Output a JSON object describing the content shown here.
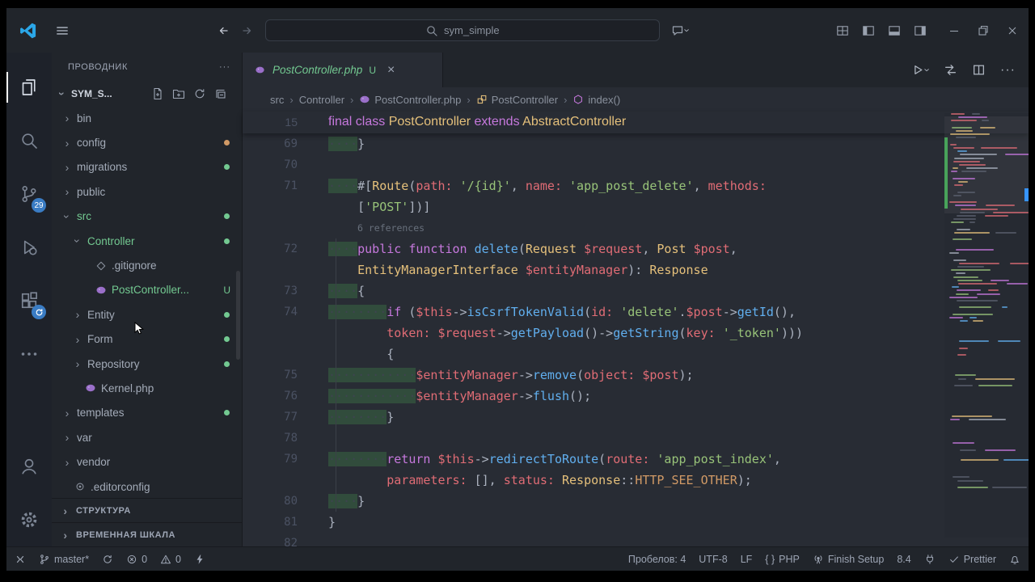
{
  "colors": {
    "kw": "#c678dd",
    "type": "#e5c07b",
    "fn": "#61afef",
    "var": "#e06c75",
    "str": "#98c379",
    "const": "#d19a66",
    "fg": "#abb2bf",
    "untracked": "#73c991",
    "badge": "#3a7cc4",
    "accent": "#3794ff",
    "editor_bg": "#282c34",
    "panel_bg": "#21252b"
  },
  "titlebar": {
    "search": "sym_simple"
  },
  "activity": {
    "items": [
      "explorer",
      "search",
      "source-control",
      "run-debug",
      "extensions",
      "more"
    ],
    "bottom": [
      "account",
      "settings"
    ],
    "scm_badge": "29"
  },
  "sidebar": {
    "title": "ПРОВОДНИК",
    "workspace": "SYM_S...",
    "tree": [
      {
        "label": "bin",
        "type": "folder",
        "level": 0
      },
      {
        "label": "config",
        "type": "folder",
        "level": 0,
        "dot": "#d19a66"
      },
      {
        "label": "migrations",
        "type": "folder",
        "level": 0,
        "dot": "#73c991"
      },
      {
        "label": "public",
        "type": "folder",
        "level": 0
      },
      {
        "label": "src",
        "type": "folder",
        "level": 0,
        "expanded": true,
        "color": "#73c991",
        "dot": "#73c991"
      },
      {
        "label": "Controller",
        "type": "folder",
        "level": 1,
        "expanded": true,
        "color": "#73c991",
        "dot": "#73c991"
      },
      {
        "label": ".gitignore",
        "type": "file",
        "icon": "gitfile",
        "level": 2
      },
      {
        "label": "PostController...",
        "type": "file",
        "icon": "php",
        "level": 2,
        "color": "#73c991",
        "badge": "U"
      },
      {
        "label": "Entity",
        "type": "folder",
        "level": 1,
        "dot": "#73c991"
      },
      {
        "label": "Form",
        "type": "folder",
        "level": 1,
        "dot": "#73c991"
      },
      {
        "label": "Repository",
        "type": "folder",
        "level": 1,
        "dot": "#73c991"
      },
      {
        "label": "Kernel.php",
        "type": "file",
        "icon": "php",
        "level": 1
      },
      {
        "label": "templates",
        "type": "folder",
        "level": 0,
        "dot": "#73c991"
      },
      {
        "label": "var",
        "type": "folder",
        "level": 0
      },
      {
        "label": "vendor",
        "type": "folder",
        "level": 0
      },
      {
        "label": ".editorconfig",
        "type": "file",
        "icon": "conffile",
        "level": 0
      }
    ],
    "sections": [
      {
        "label": "СТРУКТУРА"
      },
      {
        "label": "ВРЕМЕННАЯ ШКАЛА"
      }
    ]
  },
  "tab": {
    "title": "PostController.php",
    "git_badge": "U"
  },
  "breadcrumbs": [
    {
      "label": "src"
    },
    {
      "label": "Controller"
    },
    {
      "label": "PostController.php",
      "icon": "php"
    },
    {
      "label": "PostController",
      "icon": "classsym"
    },
    {
      "label": "index()",
      "icon": "methodsym"
    }
  ],
  "editor": {
    "sticky": {
      "n": "15",
      "ind": 0,
      "tk": [
        [
          "final class ",
          "k"
        ],
        [
          "PostController",
          "t"
        ],
        [
          " ",
          "p"
        ],
        [
          "extends",
          "k"
        ],
        [
          " ",
          "p"
        ],
        [
          "AbstractController",
          "t"
        ]
      ]
    },
    "lines": [
      {
        "n": "69",
        "ind": 4,
        "g": true,
        "tk": [
          [
            "}",
            "p"
          ]
        ]
      },
      {
        "n": "70",
        "ind": 0,
        "tk": []
      },
      {
        "n": "71",
        "ind": 4,
        "g": true,
        "tk": [
          [
            "#[",
            "p"
          ],
          [
            "Route",
            "t"
          ],
          [
            "(",
            "p"
          ],
          [
            "path:",
            "v"
          ],
          [
            " ",
            "p"
          ],
          [
            "'/{id}'",
            "s"
          ],
          [
            ", ",
            "p"
          ],
          [
            "name:",
            "v"
          ],
          [
            " ",
            "p"
          ],
          [
            "'app_post_delete'",
            "s"
          ],
          [
            ", ",
            "p"
          ],
          [
            "methods:",
            "v"
          ]
        ]
      },
      {
        "n": "",
        "ind": 4,
        "virt": true,
        "tk": [
          [
            "[",
            "p"
          ],
          [
            "'POST'",
            "s"
          ],
          [
            "])]",
            "p"
          ]
        ]
      },
      {
        "n": "",
        "ind": 4,
        "lens": "6 references"
      },
      {
        "n": "72",
        "ind": 4,
        "g": true,
        "tk": [
          [
            "public function ",
            "k"
          ],
          [
            "delete",
            "f"
          ],
          [
            "(",
            "p"
          ],
          [
            "Request",
            "t"
          ],
          [
            " ",
            "p"
          ],
          [
            "$request",
            "v"
          ],
          [
            ", ",
            "p"
          ],
          [
            "Post",
            "t"
          ],
          [
            " ",
            "p"
          ],
          [
            "$post",
            "v"
          ],
          [
            ",",
            "p"
          ]
        ]
      },
      {
        "n": "",
        "ind": 4,
        "virt": true,
        "tk": [
          [
            "EntityManagerInterface",
            "t"
          ],
          [
            " ",
            "p"
          ],
          [
            "$entityManager",
            "v"
          ],
          [
            "): ",
            "p"
          ],
          [
            "Response",
            "t"
          ]
        ]
      },
      {
        "n": "73",
        "ind": 4,
        "g": true,
        "tk": [
          [
            "{",
            "p"
          ]
        ]
      },
      {
        "n": "74",
        "ind": 8,
        "g": true,
        "tk": [
          [
            "if",
            "k"
          ],
          [
            " (",
            "p"
          ],
          [
            "$this",
            "v"
          ],
          [
            "->",
            "p"
          ],
          [
            "isCsrfTokenValid",
            "f"
          ],
          [
            "(",
            "p"
          ],
          [
            "id:",
            "v"
          ],
          [
            " ",
            "p"
          ],
          [
            "'delete'",
            "s"
          ],
          [
            ".",
            "p"
          ],
          [
            "$post",
            "v"
          ],
          [
            "->",
            "p"
          ],
          [
            "getId",
            "f"
          ],
          [
            "(),",
            "p"
          ]
        ]
      },
      {
        "n": "",
        "ind": 8,
        "virt": true,
        "tk": [
          [
            "token:",
            "v"
          ],
          [
            " ",
            "p"
          ],
          [
            "$request",
            "v"
          ],
          [
            "->",
            "p"
          ],
          [
            "getPayload",
            "f"
          ],
          [
            "()->",
            "p"
          ],
          [
            "getString",
            "f"
          ],
          [
            "(",
            "p"
          ],
          [
            "key:",
            "v"
          ],
          [
            " ",
            "p"
          ],
          [
            "'_token'",
            "s"
          ],
          [
            ")))",
            "p"
          ]
        ]
      },
      {
        "n": "",
        "ind": 8,
        "virt": true,
        "tk": [
          [
            "{",
            "p"
          ]
        ]
      },
      {
        "n": "75",
        "ind": 12,
        "g": true,
        "tk": [
          [
            "$entityManager",
            "v"
          ],
          [
            "->",
            "p"
          ],
          [
            "remove",
            "f"
          ],
          [
            "(",
            "p"
          ],
          [
            "object:",
            "v"
          ],
          [
            " ",
            "p"
          ],
          [
            "$post",
            "v"
          ],
          [
            ");",
            "p"
          ]
        ]
      },
      {
        "n": "76",
        "ind": 12,
        "g": true,
        "tk": [
          [
            "$entityManager",
            "v"
          ],
          [
            "->",
            "p"
          ],
          [
            "flush",
            "f"
          ],
          [
            "();",
            "p"
          ]
        ]
      },
      {
        "n": "77",
        "ind": 8,
        "g": true,
        "tk": [
          [
            "}",
            "p"
          ]
        ]
      },
      {
        "n": "78",
        "ind": 0,
        "tk": []
      },
      {
        "n": "79",
        "ind": 8,
        "g": true,
        "tk": [
          [
            "return ",
            "k"
          ],
          [
            "$this",
            "v"
          ],
          [
            "->",
            "p"
          ],
          [
            "redirectToRoute",
            "f"
          ],
          [
            "(",
            "p"
          ],
          [
            "route:",
            "v"
          ],
          [
            " ",
            "p"
          ],
          [
            "'app_post_index'",
            "s"
          ],
          [
            ",",
            "p"
          ]
        ]
      },
      {
        "n": "",
        "ind": 8,
        "virt": true,
        "tk": [
          [
            "parameters:",
            "v"
          ],
          [
            " ",
            "p"
          ],
          [
            "[], ",
            "p"
          ],
          [
            "status:",
            "v"
          ],
          [
            " ",
            "p"
          ],
          [
            "Response",
            "t"
          ],
          [
            "::",
            "p"
          ],
          [
            "HTTP_SEE_OTHER",
            "o"
          ],
          [
            ");",
            "p"
          ]
        ]
      },
      {
        "n": "80",
        "ind": 4,
        "g": true,
        "tk": [
          [
            "}",
            "p"
          ]
        ]
      },
      {
        "n": "81",
        "ind": 0,
        "tk": [
          [
            "}",
            "p"
          ]
        ]
      },
      {
        "n": "82",
        "ind": 0,
        "tk": []
      }
    ]
  },
  "statusbar": {
    "left": [
      {
        "icon": "remote",
        "name": "remote-indicator"
      },
      {
        "icon": "branch",
        "label": "master*",
        "name": "git-branch"
      },
      {
        "icon": "sync",
        "name": "git-sync"
      },
      {
        "icon": "error",
        "label": "0",
        "name": "errors"
      },
      {
        "icon": "warning",
        "label": "0",
        "name": "warnings"
      },
      {
        "icon": "lightning",
        "name": "quick-action"
      }
    ],
    "right": [
      {
        "label": "Пробелов: 4",
        "name": "indentation"
      },
      {
        "label": "UTF-8",
        "name": "encoding"
      },
      {
        "label": "LF",
        "name": "eol"
      },
      {
        "icon": "brackets",
        "label": "PHP",
        "name": "language-mode"
      },
      {
        "icon": "radio",
        "label": "Finish Setup",
        "name": "finish-setup"
      },
      {
        "label": "8.4",
        "name": "php-version"
      },
      {
        "icon": "plug",
        "name": "ports"
      },
      {
        "icon": "check",
        "label": "Prettier",
        "name": "prettier"
      },
      {
        "icon": "bell",
        "name": "notifications"
      }
    ]
  }
}
